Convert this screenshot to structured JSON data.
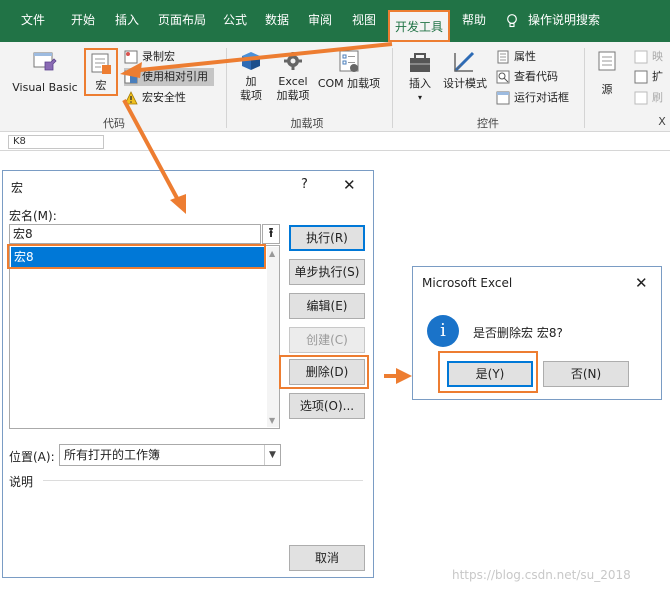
{
  "ribbon": {
    "tabs": [
      {
        "label": "文件"
      },
      {
        "label": "开始"
      },
      {
        "label": "插入"
      },
      {
        "label": "页面布局"
      },
      {
        "label": "公式"
      },
      {
        "label": "数据"
      },
      {
        "label": "审阅"
      },
      {
        "label": "视图"
      },
      {
        "label": "开发工具",
        "active": true
      },
      {
        "label": "帮助"
      }
    ],
    "tell_me": "操作说明搜索",
    "code_group": {
      "label": "代码",
      "visual_basic": "Visual Basic",
      "macros": "宏",
      "record_macro": "录制宏",
      "relative_refs": "使用相对引用",
      "macro_security": "宏安全性"
    },
    "addins_group": {
      "label": "加载项",
      "addins": "加\n载项",
      "addins_l1": "加",
      "addins_l2": "载项",
      "excel_addins_l1": "Excel",
      "excel_addins_l2": "加载项",
      "com_addins": "COM 加载项"
    },
    "controls_group": {
      "label": "控件",
      "insert": "插入",
      "design_mode": "设计模式",
      "properties": "属性",
      "view_code": "查看代码",
      "run_dialog": "运行对话框"
    },
    "xml_group": {
      "source": "源",
      "map": "映",
      "expand": "扩",
      "refresh": "刷",
      "x_partial": "X"
    },
    "name_box": "K8"
  },
  "macro_dialog": {
    "title": "宏",
    "help": "?",
    "close": "✕",
    "macro_name_label": "宏名(M):",
    "macro_name_value": "宏8",
    "list_items": [
      "宏8"
    ],
    "buttons": {
      "run": "执行(R)",
      "step_into": "单步执行(S)",
      "edit": "编辑(E)",
      "create": "创建(C)",
      "delete": "删除(D)",
      "options": "选项(O)...",
      "cancel": "取消"
    },
    "location_label": "位置(A):",
    "location_value": "所有打开的工作簿",
    "description_label": "说明"
  },
  "confirm_dialog": {
    "title": "Microsoft Excel",
    "close": "✕",
    "message": "是否删除宏 宏8?",
    "yes": "是(Y)",
    "no": "否(N)"
  },
  "watermark": "https://blog.csdn.net/su_2018",
  "colors": {
    "excel_green": "#217346",
    "highlight_orange": "#ed7d31",
    "selection_blue": "#0078d7"
  }
}
